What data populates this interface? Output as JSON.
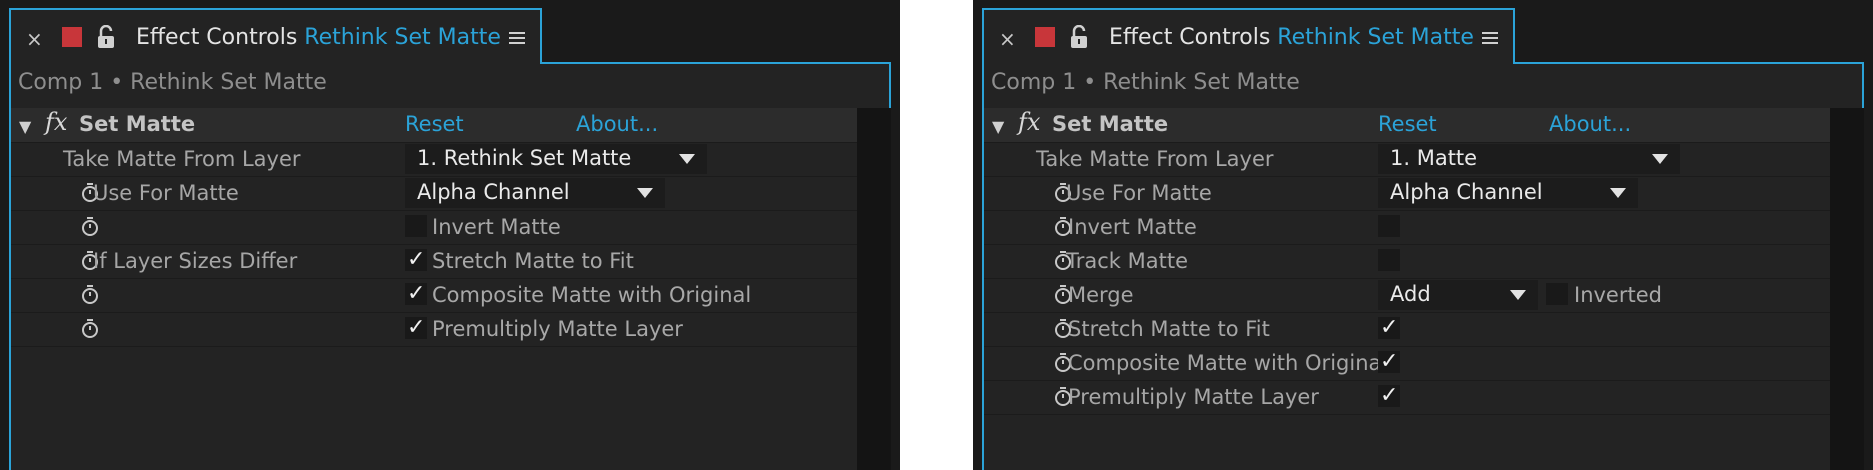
{
  "left_panel": {
    "tab": {
      "close_glyph": "×",
      "title_prefix": "Effect Controls",
      "title_layer": "Rethink Set Matte",
      "color_swatch": "#c8363a"
    },
    "breadcrumb": "Comp 1 • Rethink Set Matte",
    "effect": {
      "name": "Set Matte",
      "reset": "Reset",
      "about": "About..."
    },
    "take_matte": {
      "label": "Take Matte From Layer",
      "value": "1. Rethink Set Matte"
    },
    "use_for_matte": {
      "label": "Use For Matte",
      "value": "Alpha Channel"
    },
    "invert_matte": {
      "checkbox_label": "Invert Matte",
      "checked": false
    },
    "layer_sizes": {
      "label": "If Layer Sizes Differ",
      "checkbox_label": "Stretch Matte to Fit",
      "checked": true
    },
    "composite": {
      "checkbox_label": "Composite Matte with Original",
      "checked": true
    },
    "premultiply": {
      "checkbox_label": "Premultiply Matte Layer",
      "checked": true
    }
  },
  "right_panel": {
    "tab": {
      "close_glyph": "×",
      "title_prefix": "Effect Controls",
      "title_layer": "Rethink Set Matte",
      "color_swatch": "#c8363a"
    },
    "breadcrumb": "Comp 1 • Rethink Set Matte",
    "effect": {
      "name": "Set Matte",
      "reset": "Reset",
      "about": "About..."
    },
    "take_matte": {
      "label": "Take Matte From Layer",
      "value": "1. Matte"
    },
    "use_for_matte": {
      "label": "Use For Matte",
      "value": "Alpha Channel"
    },
    "invert_matte": {
      "label": "Invert Matte",
      "checked": false
    },
    "track_matte": {
      "label": "Track Matte",
      "checked": false
    },
    "merge": {
      "label": "Merge",
      "value": "Add",
      "inverted_label": "Inverted",
      "inverted_checked": false
    },
    "stretch": {
      "label": "Stretch Matte to Fit",
      "checked": true
    },
    "composite": {
      "label": "Composite Matte with Original",
      "checked": true
    },
    "premultiply": {
      "label": "Premultiply Matte Layer",
      "checked": true
    }
  },
  "check_glyph": "✓",
  "colors": {
    "accent": "#2ba3d8",
    "panel_bg": "#232323",
    "frame_bg": "#1a1a1a"
  }
}
